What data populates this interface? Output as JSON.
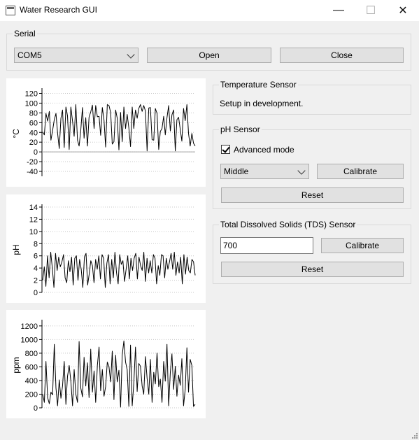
{
  "window": {
    "title": "Water Research GUI",
    "controls": {
      "minimize": "—",
      "maximize": "☐",
      "close": "✕"
    }
  },
  "serial": {
    "group_label": "Serial",
    "port_value": "COM5",
    "open_label": "Open",
    "close_label": "Close"
  },
  "temperature": {
    "group_label": "Temperature Sensor",
    "status": "Setup in development."
  },
  "ph": {
    "group_label": "pH Sensor",
    "advanced_mode_label": "Advanced mode",
    "advanced_mode_checked": true,
    "calibration_point": "Middle",
    "calibrate_label": "Calibrate",
    "reset_label": "Reset"
  },
  "tds": {
    "group_label": "Total Dissolved Solids (TDS) Sensor",
    "value": "700",
    "calibrate_label": "Calibrate",
    "reset_label": "Reset"
  },
  "colors": {
    "plot_line": "#000000",
    "grid": "#c8c8c8",
    "zero_line": "#a0a0a0"
  },
  "chart_data": [
    {
      "type": "line",
      "ylabel": "°C",
      "ylim": [
        -50,
        125
      ],
      "yticks": [
        -40,
        -20,
        0,
        20,
        40,
        60,
        80,
        100,
        120
      ],
      "grid": true,
      "zero_line": true,
      "values": [
        41,
        35,
        79,
        63,
        83,
        24,
        44,
        66,
        79,
        39,
        7,
        69,
        86,
        9,
        92,
        74,
        5,
        92,
        63,
        32,
        97,
        24,
        12,
        45,
        91,
        28,
        70,
        12,
        71,
        82,
        96,
        48,
        95,
        72,
        73,
        34,
        91,
        65,
        10,
        97,
        95,
        81,
        16,
        21,
        86,
        69,
        4,
        81,
        21,
        92,
        48,
        77,
        49,
        11,
        92,
        48,
        86,
        69,
        89,
        97,
        83,
        95,
        84,
        2,
        90,
        91,
        25,
        24,
        89,
        79,
        5,
        42,
        48,
        73,
        35,
        70,
        95,
        43,
        76,
        86,
        2,
        66,
        71,
        46,
        22,
        89,
        64,
        97,
        38,
        12,
        38,
        18,
        12
      ]
    },
    {
      "type": "line",
      "ylabel": "pH",
      "ylim": [
        0,
        14
      ],
      "yticks": [
        0,
        2,
        4,
        6,
        8,
        10,
        12,
        14
      ],
      "grid": true,
      "values": [
        2.0,
        4.2,
        1.0,
        6.0,
        2.4,
        6.6,
        4.0,
        0.8,
        6.4,
        3.6,
        5.8,
        4.2,
        5.0,
        6.2,
        2.4,
        1.6,
        5.2,
        3.4,
        5.8,
        1.2,
        5.6,
        6.0,
        2.0,
        5.4,
        3.8,
        0.8,
        5.8,
        6.4,
        1.2,
        3.0,
        5.2,
        4.4,
        1.6,
        5.4,
        3.8,
        6.0,
        2.2,
        6.2,
        5.6,
        0.8,
        4.8,
        6.2,
        1.4,
        5.4,
        2.4,
        6.6,
        3.2,
        1.4,
        6.2,
        4.6,
        5.2,
        1.8,
        3.8,
        6.0,
        2.2,
        5.6,
        3.6,
        5.6,
        6.4,
        2.2,
        5.8,
        4.4,
        3.6,
        6.6,
        1.8,
        5.6,
        3.2,
        5.2,
        3.2,
        6.2,
        5.6,
        1.4,
        4.4,
        2.8,
        6.2,
        6.0,
        2.4,
        5.6,
        3.8,
        5.0,
        6.4,
        3.8,
        6.6,
        2.8,
        5.0,
        3.2,
        5.8,
        1.4,
        6.2,
        3.0,
        5.8,
        3.6,
        3.2,
        5.4,
        5.0,
        2.8
      ]
    },
    {
      "type": "line",
      "ylabel": "ppm",
      "ylim": [
        0,
        1250
      ],
      "yticks": [
        0,
        200,
        400,
        600,
        800,
        1000,
        1200
      ],
      "grid": true,
      "values": [
        200,
        80,
        680,
        150,
        60,
        230,
        190,
        930,
        290,
        30,
        410,
        140,
        320,
        680,
        50,
        460,
        620,
        390,
        30,
        560,
        200,
        80,
        970,
        290,
        160,
        740,
        320,
        660,
        150,
        860,
        230,
        540,
        80,
        620,
        890,
        250,
        560,
        170,
        310,
        670,
        600,
        380,
        830,
        120,
        770,
        380,
        550,
        10,
        770,
        980,
        670,
        560,
        20,
        920,
        30,
        360,
        890,
        240,
        650,
        610,
        320,
        200,
        750,
        430,
        200,
        710,
        80,
        520,
        350,
        800,
        310,
        420,
        80,
        680,
        390,
        930,
        30,
        520,
        790,
        270,
        610,
        170,
        480,
        330,
        720,
        30,
        270,
        880,
        230,
        710,
        620,
        20,
        50
      ]
    }
  ]
}
